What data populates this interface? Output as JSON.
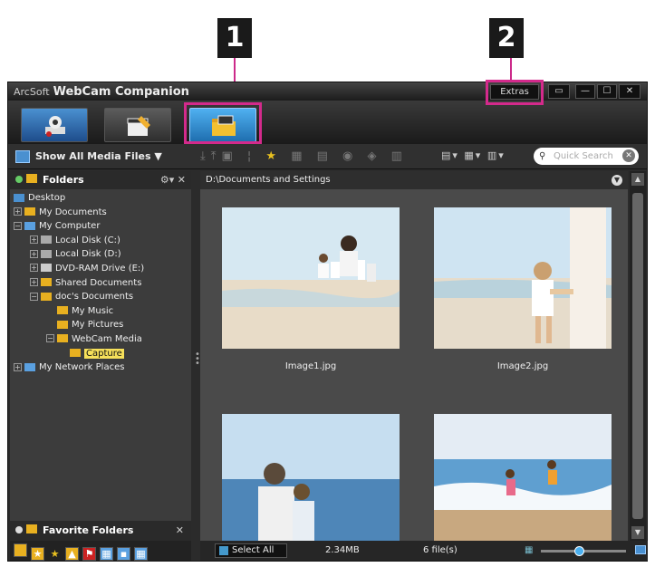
{
  "callouts": {
    "one": "1",
    "two": "2"
  },
  "window": {
    "brand": "ArcSoft",
    "app_name": "WebCam Companion",
    "extras_label": "Extras",
    "controls": [
      "▭",
      "—",
      "☐",
      "✕"
    ]
  },
  "modes": [
    {
      "name": "capture-mode",
      "icon": "webcam-icon"
    },
    {
      "name": "edit-mode",
      "icon": "clapperboard-pencil-icon"
    },
    {
      "name": "media-mode",
      "icon": "folder-clapperboard-icon",
      "active": true
    }
  ],
  "toolbar": {
    "show_all_label": "Show All Media Files",
    "search_placeholder": "Quick Search"
  },
  "folders": {
    "header": "Folders",
    "tree": [
      {
        "label": "Desktop",
        "depth": 0,
        "icon": "desktop-icon"
      },
      {
        "label": "My Documents",
        "depth": 1,
        "icon": "folder-icon"
      },
      {
        "label": "My Computer",
        "depth": 1,
        "icon": "computer-icon"
      },
      {
        "label": "Local Disk (C:)",
        "depth": 2,
        "icon": "drive-icon"
      },
      {
        "label": "Local Disk (D:)",
        "depth": 2,
        "icon": "drive-icon"
      },
      {
        "label": "DVD-RAM Drive (E:)",
        "depth": 2,
        "icon": "dvd-icon"
      },
      {
        "label": "Shared Documents",
        "depth": 2,
        "icon": "folder-icon"
      },
      {
        "label": "doc's Documents",
        "depth": 2,
        "icon": "folder-icon"
      },
      {
        "label": "My Music",
        "depth": 3,
        "icon": "music-folder-icon"
      },
      {
        "label": "My Pictures",
        "depth": 3,
        "icon": "pictures-folder-icon"
      },
      {
        "label": "WebCam Media",
        "depth": 3,
        "icon": "folder-icon"
      },
      {
        "label": "Capture",
        "depth": 4,
        "icon": "folder-icon",
        "selected": true
      },
      {
        "label": "My Network Places",
        "depth": 0,
        "icon": "network-icon"
      }
    ]
  },
  "favorites": {
    "header": "Favorite Folders"
  },
  "main": {
    "path": "D:\\Documents and Settings",
    "thumbnails": [
      {
        "caption": "Image1.jpg",
        "scene": "family-beach-shore"
      },
      {
        "caption": "Image2.jpg",
        "scene": "mother-child-holding-hands"
      },
      {
        "caption": "",
        "scene": "father-child-sea"
      },
      {
        "caption": "",
        "scene": "kids-running-waves"
      }
    ]
  },
  "status": {
    "select_all": "Select All",
    "size": "2.34MB",
    "count": "6 file(s)",
    "zoom_level": 0.45
  }
}
